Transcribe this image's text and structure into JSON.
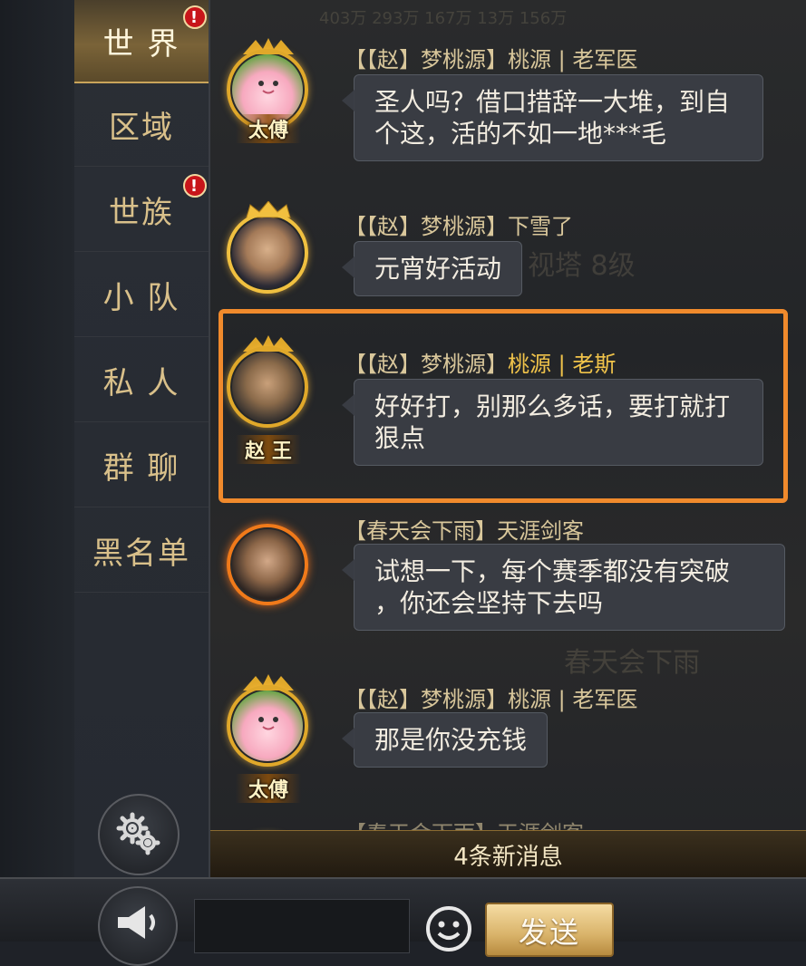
{
  "sidebar": {
    "tabs": [
      {
        "label": "世 界",
        "badge": "!"
      },
      {
        "label": "区域",
        "badge": ""
      },
      {
        "label": "世族",
        "badge": "!"
      },
      {
        "label": "小 队",
        "badge": ""
      },
      {
        "label": "私 人",
        "badge": ""
      },
      {
        "label": "群 聊",
        "badge": ""
      },
      {
        "label": "黑名单",
        "badge": ""
      }
    ],
    "settings_icon": "gear-icon"
  },
  "background_text": {
    "tower": "视塔 8级",
    "team": "春天会下雨",
    "numbers": "403万  293万  167万  13万  156万"
  },
  "messages": [
    {
      "name_prefix": "【【赵】梦桃源】桃源 | 老军医",
      "name_highlight": "",
      "text_lines": [
        "圣人吗？借口措辞一大堆，到自",
        "个这，活的不如一地***毛"
      ],
      "title": "太傅",
      "avatar": "peach-avatar-icon"
    },
    {
      "name_prefix": "【【赵】梦桃源】下雪了",
      "name_highlight": "",
      "text_lines": [
        "元宵好活动"
      ],
      "title": "",
      "avatar": "emperor-avatar-icon"
    },
    {
      "name_prefix": "【【赵】梦桃源】",
      "name_highlight": "桃源 | 老斯",
      "text_lines": [
        "好好打，别那么多话，要打就打",
        "狠点"
      ],
      "title": "赵 王",
      "avatar": "warrior-avatar-icon"
    },
    {
      "name_prefix": "【春天会下雨】天涯剑客",
      "name_highlight": "",
      "text_lines": [
        "试想一下，每个赛季都没有突破",
        "，你还会坚持下去吗"
      ],
      "title": "",
      "avatar": "swordsman-avatar-icon"
    },
    {
      "name_prefix": "【【赵】梦桃源】桃源 | 老军医",
      "name_highlight": "",
      "text_lines": [
        "那是你没充钱"
      ],
      "title": "太傅",
      "avatar": "peach-avatar-icon"
    },
    {
      "name_prefix": "【春天会下雨】天涯剑客",
      "name_highlight": "",
      "text_lines": [],
      "title": "",
      "avatar": "swordsman-avatar-icon"
    }
  ],
  "new_messages_label": "4条新消息",
  "bottom": {
    "voice_icon": "speaker-icon",
    "input_value": "",
    "emoji_icon": "smiley-icon",
    "send_label": "发送"
  },
  "colors": {
    "accent_gold": "#d9c08a",
    "highlight_frame": "#f08a2c",
    "name_highlight": "#f0c34a",
    "badge_red": "#c8151a"
  }
}
